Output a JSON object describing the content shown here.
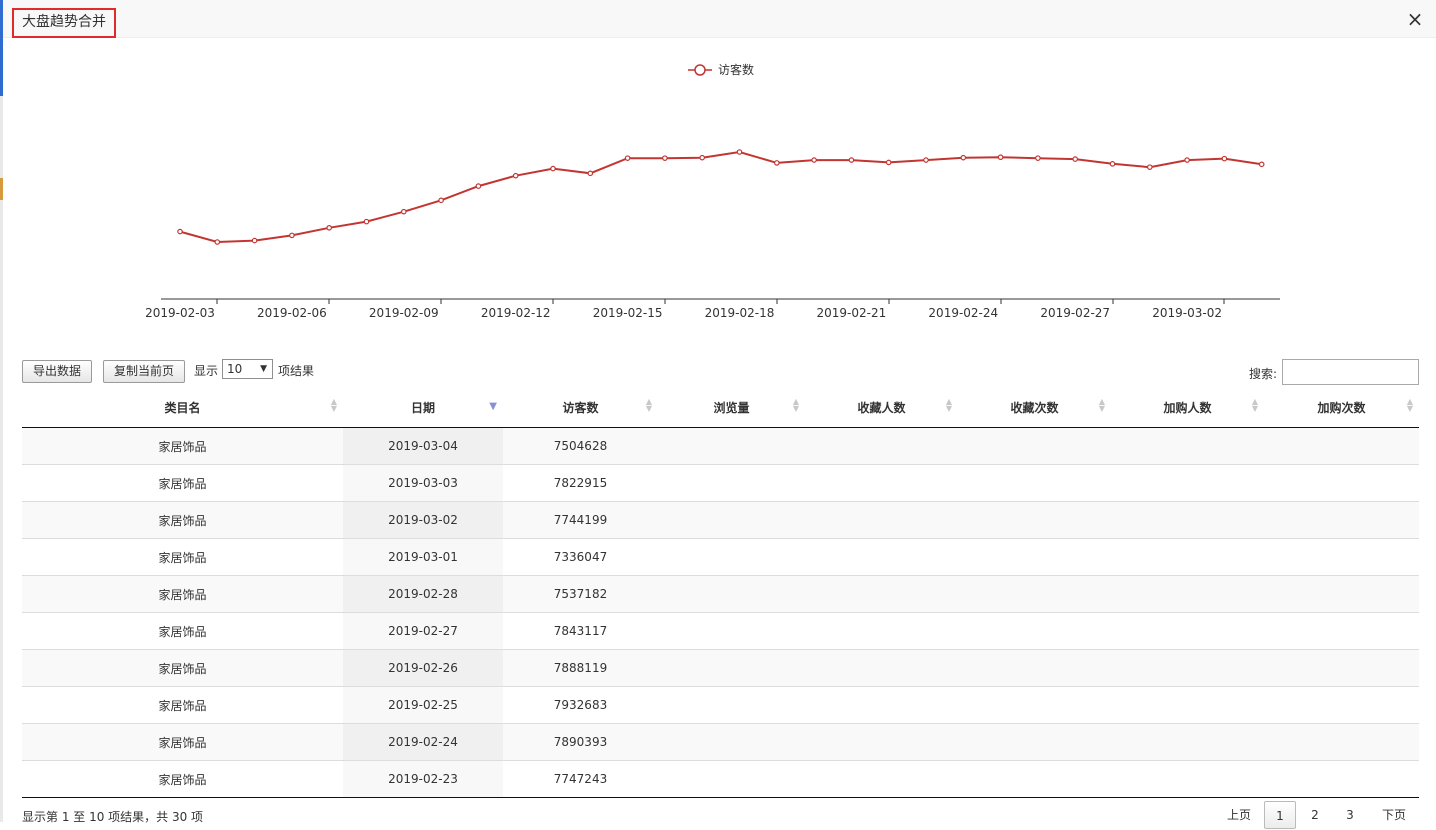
{
  "window": {
    "title": "大盘趋势合并",
    "close_icon": "×"
  },
  "chart_data": {
    "type": "line",
    "series": [
      {
        "name": "访客数",
        "color": "#c23531",
        "values": [
          6380000,
          6160000,
          6190000,
          6300000,
          6460000,
          6590000,
          6800000,
          7040000,
          7340000,
          7560000,
          7710000,
          7610000,
          7930000,
          7930000,
          7940000,
          8060000,
          7830000,
          7890000,
          7890000,
          7840000,
          7890000,
          7940000,
          7950000,
          7930000,
          7910000,
          7810000,
          7740000,
          7890000,
          7920000,
          7800000
        ]
      }
    ],
    "x": [
      "2019-02-03",
      "2019-02-04",
      "2019-02-05",
      "2019-02-06",
      "2019-02-07",
      "2019-02-08",
      "2019-02-09",
      "2019-02-10",
      "2019-02-11",
      "2019-02-12",
      "2019-02-13",
      "2019-02-14",
      "2019-02-15",
      "2019-02-16",
      "2019-02-17",
      "2019-02-18",
      "2019-02-19",
      "2019-02-20",
      "2019-02-21",
      "2019-02-22",
      "2019-02-23",
      "2019-02-24",
      "2019-02-25",
      "2019-02-26",
      "2019-02-27",
      "2019-02-28",
      "2019-03-01",
      "2019-03-02",
      "2019-03-03",
      "2019-03-04"
    ],
    "tick_labels": [
      "2019-02-03",
      "2019-02-06",
      "2019-02-09",
      "2019-02-12",
      "2019-02-15",
      "2019-02-18",
      "2019-02-21",
      "2019-02-24",
      "2019-02-27",
      "2019-03-02"
    ],
    "legend": "top-center",
    "grid": false
  },
  "toolbar": {
    "export_label": "导出数据",
    "copy_label": "复制当前页",
    "show_label": "显示",
    "page_size": "10",
    "results_label": "项结果",
    "search_label": "搜索:",
    "search_value": ""
  },
  "table": {
    "headers": [
      "类目名",
      "日期",
      "访客数",
      "浏览量",
      "收藏人数",
      "收藏次数",
      "加购人数",
      "加购次数"
    ],
    "rows": [
      [
        "家居饰品",
        "2019-03-04",
        "7504628",
        "",
        "",
        "",
        "",
        ""
      ],
      [
        "家居饰品",
        "2019-03-03",
        "7822915",
        "",
        "",
        "",
        "",
        ""
      ],
      [
        "家居饰品",
        "2019-03-02",
        "7744199",
        "",
        "",
        "",
        "",
        ""
      ],
      [
        "家居饰品",
        "2019-03-01",
        "7336047",
        "",
        "",
        "",
        "",
        ""
      ],
      [
        "家居饰品",
        "2019-02-28",
        "7537182",
        "",
        "",
        "",
        "",
        ""
      ],
      [
        "家居饰品",
        "2019-02-27",
        "7843117",
        "",
        "",
        "",
        "",
        ""
      ],
      [
        "家居饰品",
        "2019-02-26",
        "7888119",
        "",
        "",
        "",
        "",
        ""
      ],
      [
        "家居饰品",
        "2019-02-25",
        "7932683",
        "",
        "",
        "",
        "",
        ""
      ],
      [
        "家居饰品",
        "2019-02-24",
        "7890393",
        "",
        "",
        "",
        "",
        ""
      ],
      [
        "家居饰品",
        "2019-02-23",
        "7747243",
        "",
        "",
        "",
        "",
        ""
      ]
    ],
    "sorted_column": "日期",
    "sort_direction": "desc"
  },
  "footer": {
    "info": "显示第 1 至 10 项结果，共 30 项",
    "prev_label": "上页",
    "pages": [
      "1",
      "2",
      "3"
    ],
    "current_page": "1",
    "next_label": "下页"
  }
}
